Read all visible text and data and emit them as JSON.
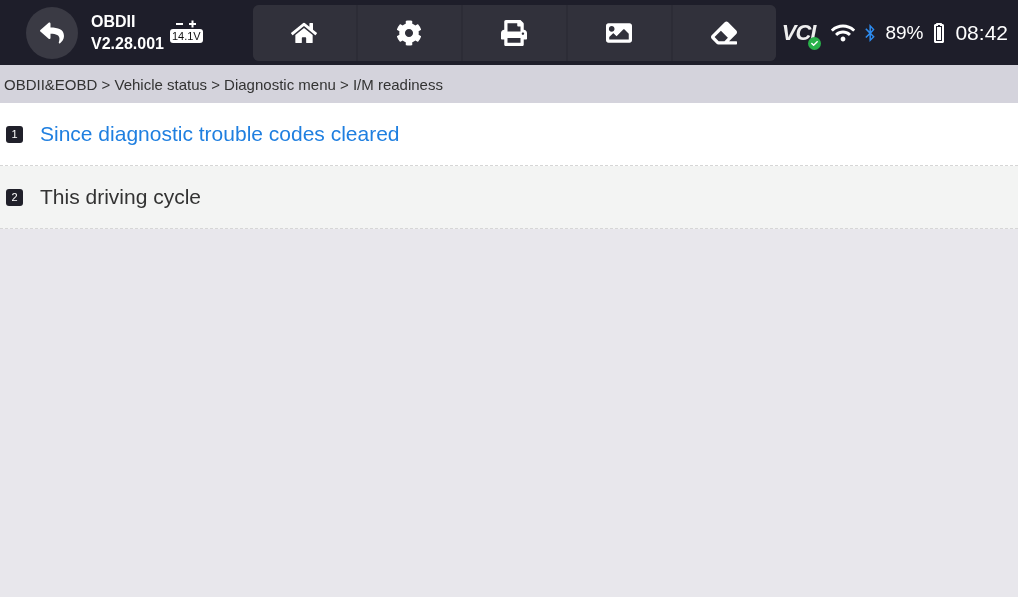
{
  "header": {
    "title": "OBDII",
    "version": "V2.28.001",
    "battery_voltage": "14.1V"
  },
  "toolbar": [
    {
      "kind": "home"
    },
    {
      "kind": "settings"
    },
    {
      "kind": "print"
    },
    {
      "kind": "image"
    },
    {
      "kind": "erase"
    }
  ],
  "status_bar": {
    "vci_logo": "VCI",
    "vci_connected": true,
    "battery": "89%",
    "time": "08:42"
  },
  "breadcrumb": "OBDII&EOBD > Vehicle status > Diagnostic menu > I/M readiness",
  "menu": [
    {
      "number": "1",
      "label": "Since diagnostic trouble codes cleared",
      "selected": true
    },
    {
      "number": "2",
      "label": "This driving cycle",
      "selected": false
    }
  ]
}
